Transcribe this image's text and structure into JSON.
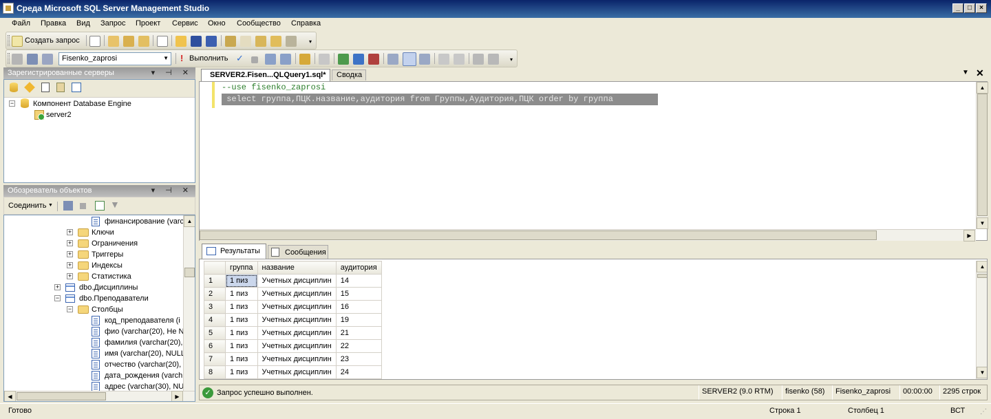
{
  "window": {
    "title": "Среда Microsoft SQL Server Management Studio"
  },
  "menu": [
    "Файл",
    "Правка",
    "Вид",
    "Запрос",
    "Проект",
    "Сервис",
    "Окно",
    "Сообщество",
    "Справка"
  ],
  "toolbar1": {
    "new_query_label": "Создать запрос"
  },
  "toolbar2": {
    "database": "Fisenko_zaprosi",
    "execute_label": "Выполнить"
  },
  "registered_servers": {
    "title": "Зарегистрированные серверы",
    "root": "Компонент Database Engine",
    "server": "server2"
  },
  "object_explorer": {
    "title": "Обозреватель объектов",
    "connect_label": "Соединить",
    "nodes": [
      {
        "label": "финансирование (varc",
        "kind": "column"
      },
      {
        "label": "Ключи",
        "kind": "folder"
      },
      {
        "label": "Ограничения",
        "kind": "folder"
      },
      {
        "label": "Триггеры",
        "kind": "folder"
      },
      {
        "label": "Индексы",
        "kind": "folder"
      },
      {
        "label": "Статистика",
        "kind": "folder"
      },
      {
        "label": "dbo.Дисциплины",
        "kind": "table"
      },
      {
        "label": "dbo.Преподаватели",
        "kind": "table"
      },
      {
        "label": "Столбцы",
        "kind": "folder"
      },
      {
        "label": "код_преподавателя (i",
        "kind": "column"
      },
      {
        "label": "фио (varchar(20), Не N",
        "kind": "column"
      },
      {
        "label": "фамилия (varchar(20),",
        "kind": "column"
      },
      {
        "label": "имя (varchar(20), NULL",
        "kind": "column"
      },
      {
        "label": "отчество (varchar(20),",
        "kind": "column"
      },
      {
        "label": "дата_рождения (varch",
        "kind": "column"
      },
      {
        "label": "адрес (varchar(30), NU",
        "kind": "column"
      }
    ]
  },
  "tabs": {
    "active": "SERVER2.Fisen...QLQuery1.sql*",
    "other": "Сводка"
  },
  "editor": {
    "line1": "--use fisenko_zaprosi",
    "line2": " select группа,ПЦК.название,аудитория from Группы,Аудитория,ПЦК order by группа"
  },
  "results_tabs": {
    "results": "Результаты",
    "messages": "Сообщения"
  },
  "grid": {
    "columns": [
      "группа",
      "название",
      "аудитория"
    ],
    "rows": [
      [
        "1",
        "1 пиз",
        "Учетных дисциплин",
        "14"
      ],
      [
        "2",
        "1 пиз",
        "Учетных дисциплин",
        "15"
      ],
      [
        "3",
        "1 пиз",
        "Учетных дисциплин",
        "16"
      ],
      [
        "4",
        "1 пиз",
        "Учетных дисциплин",
        "19"
      ],
      [
        "5",
        "1 пиз",
        "Учетных дисциплин",
        "21"
      ],
      [
        "6",
        "1 пиз",
        "Учетных дисциплин",
        "22"
      ],
      [
        "7",
        "1 пиз",
        "Учетных дисциплин",
        "23"
      ],
      [
        "8",
        "1 пиз",
        "Учетных дисциплин",
        "24"
      ]
    ]
  },
  "query_status": {
    "message": "Запрос успешно выполнен.",
    "server": "SERVER2 (9.0 RTM)",
    "user": "fisenko (58)",
    "database": "Fisenko_zaprosi",
    "time": "00:00:00",
    "rows": "2295 строк"
  },
  "statusbar": {
    "ready": "Готово",
    "line": "Строка 1",
    "column": "Столбец 1",
    "mode": "ВСТ"
  }
}
